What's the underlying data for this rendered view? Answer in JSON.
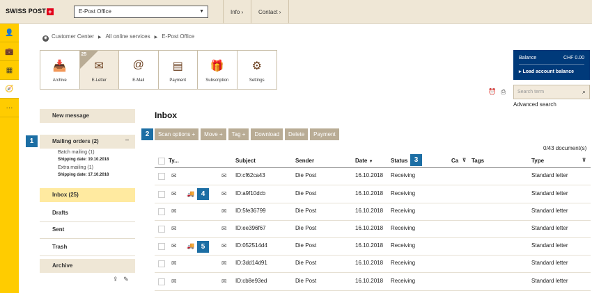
{
  "header": {
    "logo_text": "SWISS POST",
    "logo_cross": "+",
    "service_select": "E-Post Office",
    "links": [
      "Info",
      "Contact"
    ]
  },
  "rail_icons": [
    "person-icon",
    "briefcase-icon",
    "building-icon",
    "compass-icon",
    "more-icon"
  ],
  "breadcrumb": [
    "Customer Center",
    "All online services",
    "E-Post Office"
  ],
  "tiles": [
    {
      "label": "Archive",
      "icon": "inbox-tray-icon"
    },
    {
      "label": "E-Letter",
      "icon": "envelope-stack-icon",
      "badge": "25"
    },
    {
      "label": "E-Mail",
      "icon": "email-at-icon"
    },
    {
      "label": "Payment",
      "icon": "payment-icon"
    },
    {
      "label": "Subscription",
      "icon": "gift-icon"
    },
    {
      "label": "Settings",
      "icon": "gears-icon"
    }
  ],
  "balance": {
    "label": "Balance",
    "amount": "CHF 0.00",
    "load": "Load account balance"
  },
  "search": {
    "placeholder": "Search term",
    "advanced": "Advanced search"
  },
  "nav": {
    "new_message": "New message",
    "mailing_orders": "Mailing orders (2)",
    "batch": "Batch mailing (1)",
    "batch_date": "Shipping date: 19.10.2018",
    "extra": "Extra mailing (1)",
    "extra_date": "Shipping date: 17.10.2018",
    "inbox": "Inbox (25)",
    "drafts": "Drafts",
    "sent": "Sent",
    "trash": "Trash",
    "archive": "Archive"
  },
  "callouts": [
    "1",
    "2",
    "3",
    "4",
    "5"
  ],
  "main": {
    "title": "Inbox",
    "actions": [
      "Scan options",
      "Move",
      "Tag",
      "Download",
      "Delete",
      "Payment"
    ],
    "action_plus": "+",
    "doc_count": "0/43 document(s)",
    "columns": {
      "type": "Ty...",
      "subject": "Subject",
      "sender": "Sender",
      "date": "Date",
      "status": "Status",
      "ca": "Ca",
      "tags": "Tags",
      "typecol": "Type"
    },
    "rows": [
      {
        "subject": "ID:cf62ca43",
        "sender": "Die Post",
        "date": "16.10.2018",
        "status": "Receiving",
        "type": "Standard letter"
      },
      {
        "subject": "ID:a9f10dcb",
        "sender": "Die Post",
        "date": "16.10.2018",
        "status": "Receiving",
        "type": "Standard letter"
      },
      {
        "subject": "ID:5fe36799",
        "sender": "Die Post",
        "date": "16.10.2018",
        "status": "Receiving",
        "type": "Standard letter"
      },
      {
        "subject": "ID:ee396f67",
        "sender": "Die Post",
        "date": "16.10.2018",
        "status": "Receiving",
        "type": "Standard letter"
      },
      {
        "subject": "ID:052514d4",
        "sender": "Die Post",
        "date": "16.10.2018",
        "status": "Receiving",
        "type": "Standard letter"
      },
      {
        "subject": "ID:3dd14d91",
        "sender": "Die Post",
        "date": "16.10.2018",
        "status": "Receiving",
        "type": "Standard letter"
      },
      {
        "subject": "ID:cb8e93ed",
        "sender": "Die Post",
        "date": "16.10.2018",
        "status": "Receiving",
        "type": "Standard letter"
      }
    ]
  }
}
